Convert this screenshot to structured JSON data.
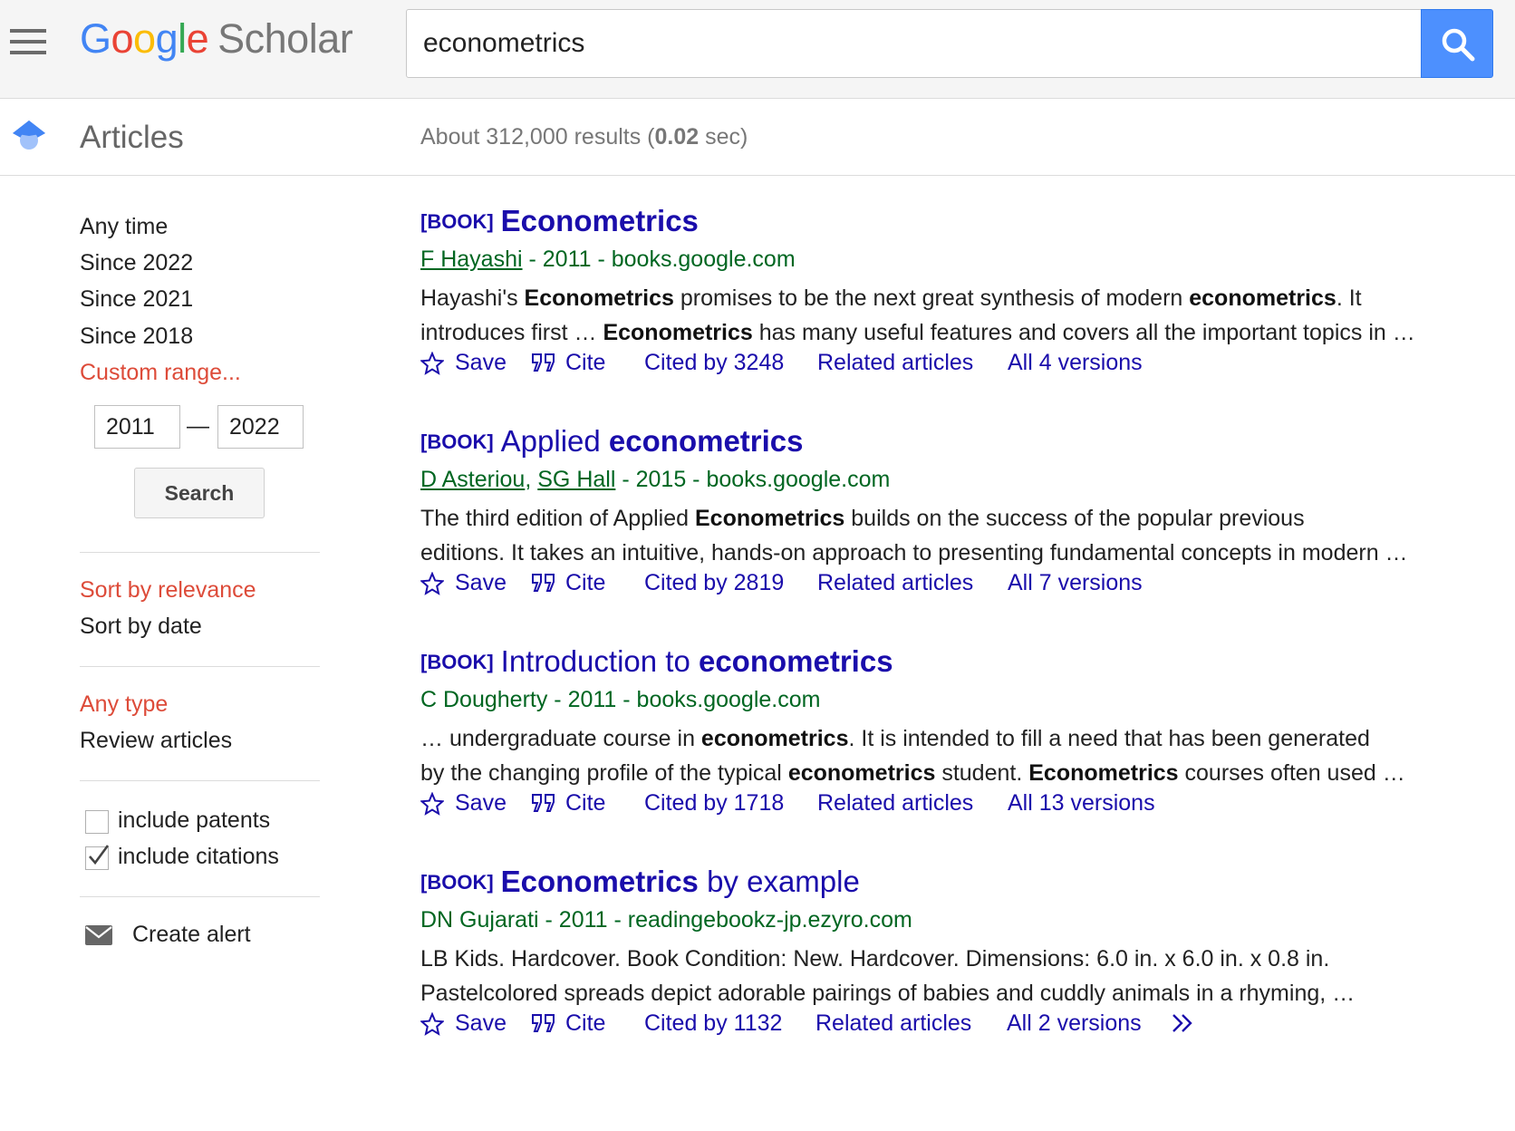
{
  "header": {
    "logo_google": "Google",
    "logo_scholar": "Scholar",
    "search_value": "econometrics"
  },
  "subheader": {
    "section_label": "Articles",
    "stats_prefix": "About 312,000 results (",
    "stats_time": "0.02",
    "stats_suffix": " sec)"
  },
  "sidebar": {
    "time_filters": [
      "Any time",
      "Since 2022",
      "Since 2021",
      "Since 2018",
      "Custom range..."
    ],
    "custom_from": "2011",
    "custom_to": "2022",
    "custom_sep": "—",
    "search_label": "Search",
    "sort_options": [
      "Sort by relevance",
      "Sort by date"
    ],
    "type_options": [
      "Any type",
      "Review articles"
    ],
    "include_patents_label": "include patents",
    "include_patents_checked": false,
    "include_citations_label": "include citations",
    "include_citations_checked": true,
    "create_alert_label": "Create alert"
  },
  "results": [
    {
      "tag": "[BOOK]",
      "title_plain": "",
      "title_bold": "Econometrics",
      "title_rest": "",
      "authors": [
        "F Hayashi"
      ],
      "authors_linked": [
        true
      ],
      "meta_rest": " - 2011 - books.google.com",
      "snippet_lines": [
        [
          "Hayashi's ",
          "**Econometrics",
          " promises to be the next great synthesis of modern ",
          "**econometrics",
          ". It"
        ],
        [
          "introduces first … ",
          "**Econometrics",
          " has many useful features and covers all the important topics in …"
        ]
      ],
      "save_label": "Save",
      "cite_label": "Cite",
      "cited_by": "Cited by 3248",
      "related": "Related articles",
      "versions": "All 4 versions"
    },
    {
      "tag": "[BOOK]",
      "title_plain": "Applied ",
      "title_bold": "econometrics",
      "title_rest": "",
      "authors": [
        "D Asteriou",
        "SG Hall"
      ],
      "authors_linked": [
        true,
        true
      ],
      "meta_rest": " - 2015 - books.google.com",
      "snippet_lines": [
        [
          "The third edition of Applied ",
          "**Econometrics",
          " builds on the success of the popular previous"
        ],
        [
          "editions. It takes an intuitive, hands-on approach to presenting fundamental concepts in modern …"
        ]
      ],
      "save_label": "Save",
      "cite_label": "Cite",
      "cited_by": "Cited by 2819",
      "related": "Related articles",
      "versions": "All 7 versions"
    },
    {
      "tag": "[BOOK]",
      "title_plain": "Introduction to ",
      "title_bold": "econometrics",
      "title_rest": "",
      "authors": [
        "C Dougherty"
      ],
      "authors_linked": [
        false
      ],
      "meta_rest": " - 2011 - books.google.com",
      "snippet_lines": [
        [
          "… undergraduate course in ",
          "**econometrics",
          ". It is intended to fill a need that has been generated"
        ],
        [
          "by the changing profile of the typical ",
          "**econometrics",
          " student. ",
          "**Econometrics",
          " courses often used …"
        ]
      ],
      "save_label": "Save",
      "cite_label": "Cite",
      "cited_by": "Cited by 1718",
      "related": "Related articles",
      "versions": "All 13 versions"
    },
    {
      "tag": "[BOOK]",
      "title_plain": "",
      "title_bold": "Econometrics",
      "title_rest": " by example",
      "authors": [
        "DN Gujarati"
      ],
      "authors_linked": [
        false
      ],
      "meta_rest": " - 2011 - readingebookz-jp.ezyro.com",
      "snippet_lines": [
        [
          "LB Kids. Hardcover. Book Condition: New. Hardcover. Dimensions: 6.0 in. x 6.0 in. x 0.8 in."
        ],
        [
          "Pastelcolored spreads depict adorable pairings of babies and cuddly animals in a rhyming, …"
        ]
      ],
      "save_label": "Save",
      "cite_label": "Cite",
      "cited_by": "Cited by 1132",
      "related": "Related articles",
      "versions": "All 2 versions"
    }
  ]
}
